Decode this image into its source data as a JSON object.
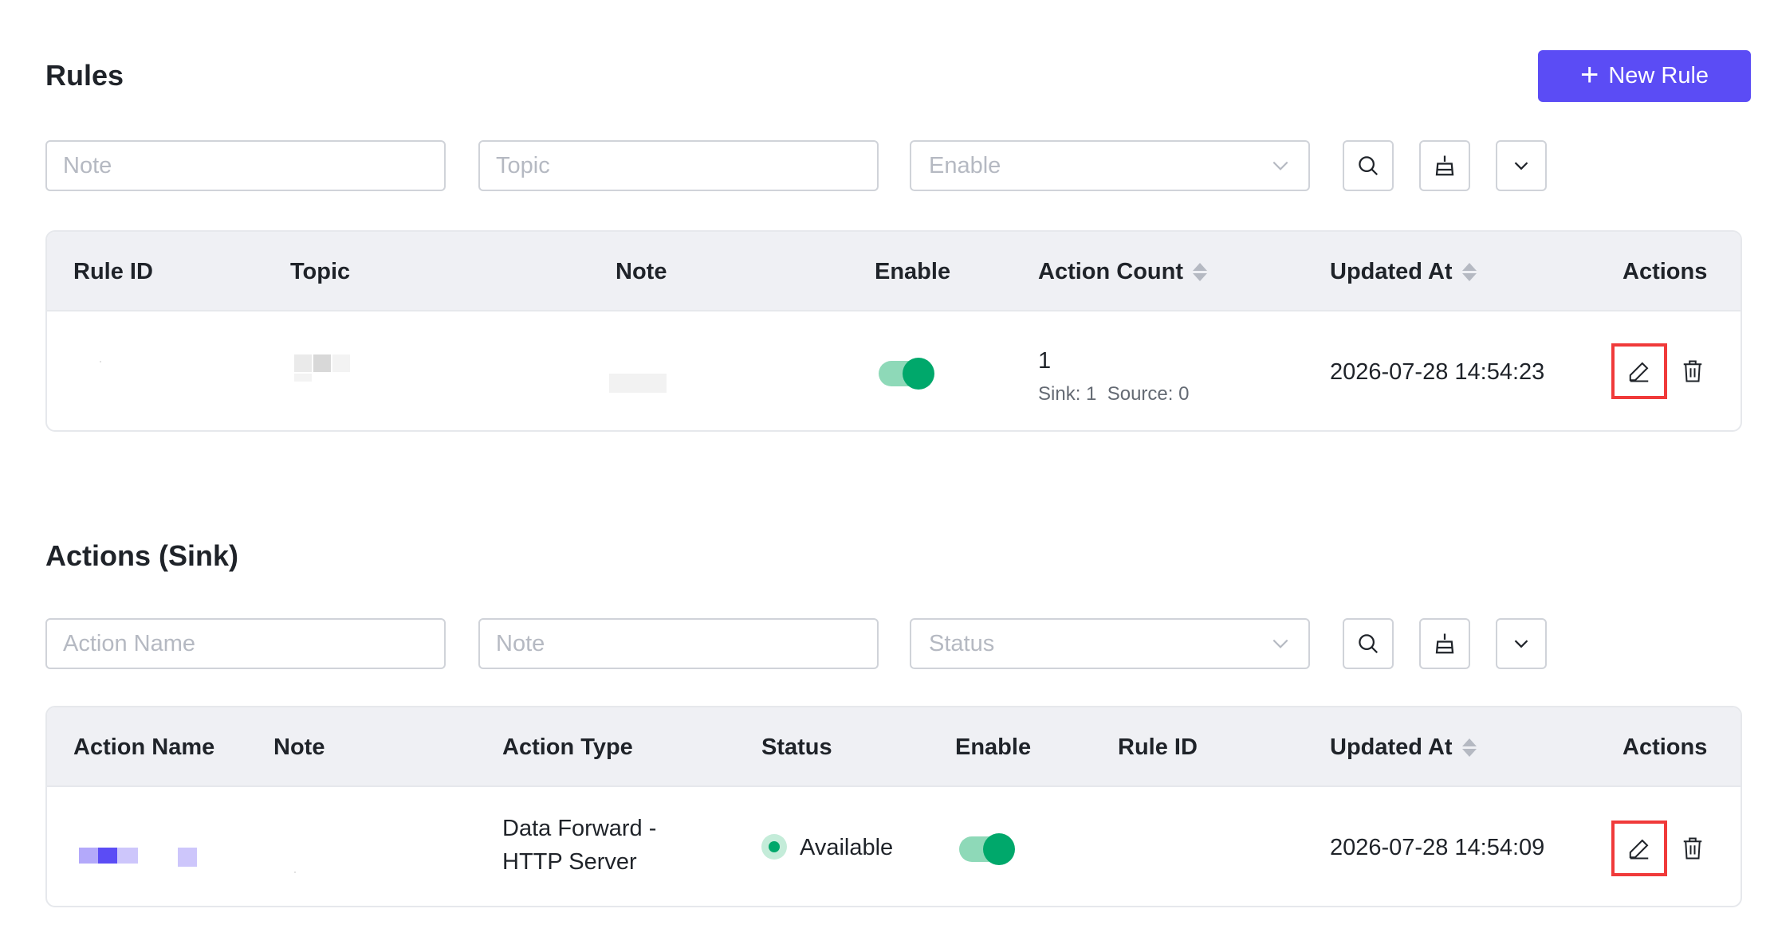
{
  "rules": {
    "title": "Rules",
    "new_button": "New Rule",
    "filters": {
      "note_placeholder": "Note",
      "topic_placeholder": "Topic",
      "enable_placeholder": "Enable"
    },
    "columns": {
      "rule_id": "Rule ID",
      "topic": "Topic",
      "note": "Note",
      "enable": "Enable",
      "action_count": "Action Count",
      "updated_at": "Updated At",
      "actions": "Actions"
    },
    "rows": [
      {
        "enabled": true,
        "action_count": "1",
        "action_count_detail": "Sink: 1  Source: 0",
        "updated_at": "2026-07-28 14:54:23"
      }
    ]
  },
  "actions_sink": {
    "title": "Actions (Sink)",
    "filters": {
      "action_name_placeholder": "Action Name",
      "note_placeholder": "Note",
      "status_placeholder": "Status"
    },
    "columns": {
      "action_name": "Action Name",
      "note": "Note",
      "action_type": "Action Type",
      "status": "Status",
      "enable": "Enable",
      "rule_id": "Rule ID",
      "updated_at": "Updated At",
      "actions": "Actions"
    },
    "rows": [
      {
        "action_type_line1": "Data Forward -",
        "action_type_line2": "HTTP Server",
        "status": "Available",
        "enabled": true,
        "updated_at": "2026-07-28 14:54:09"
      }
    ]
  },
  "colors": {
    "primary": "#5b4cf5",
    "success": "#00a86b",
    "highlight_border": "#f03a3a"
  },
  "icons": [
    "plus-icon",
    "search-icon",
    "clear-icon",
    "chevron-down-icon",
    "edit-icon",
    "delete-icon"
  ]
}
